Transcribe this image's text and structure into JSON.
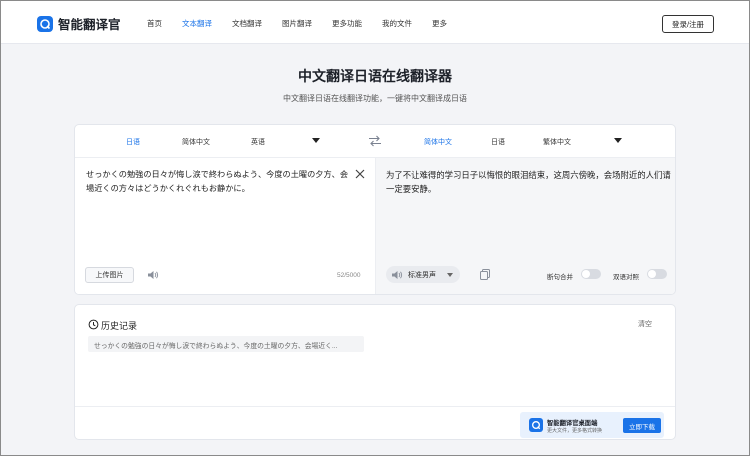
{
  "app": {
    "name": "智能翻译官",
    "accent_color": "#1a73e8"
  },
  "nav": {
    "items": [
      {
        "label": "首页",
        "active": false
      },
      {
        "label": "文本翻译",
        "active": true
      },
      {
        "label": "文档翻译",
        "active": false
      },
      {
        "label": "图片翻译",
        "active": false
      },
      {
        "label": "更多功能",
        "active": false
      },
      {
        "label": "我的文件",
        "active": false
      },
      {
        "label": "更多",
        "active": false
      }
    ],
    "login_label": "登录/注册"
  },
  "page": {
    "title": "中文翻译日语在线翻译器",
    "subtitle": "中文翻译日语在线翻译功能，一键将中文翻译成日语"
  },
  "translator": {
    "source_langs": [
      "日语",
      "简体中文",
      "英语"
    ],
    "source_selected": "日语",
    "target_langs": [
      "简体中文",
      "日语",
      "繁体中文"
    ],
    "target_selected": "简体中文",
    "source_text": "せっかくの勉強の日々が悔し涙で終わらぬよう、今度の土曜の夕方、会場近くの方々はどうかくれぐれもお静かに。",
    "target_text": "为了不让难得的学习日子以悔恨的眼泪结束，这周六傍晚，会场附近的人们请一定要安静。",
    "upload_label": "上传图片",
    "char_count": "52/5000",
    "voice_label": "标准男声",
    "toggles": [
      {
        "label": "断句合并",
        "on": false
      },
      {
        "label": "双语对照",
        "on": false
      }
    ]
  },
  "history": {
    "title": "历史记录",
    "clear_label": "清空",
    "items": [
      "せっかくの勉強の日々が悔し涙で終わらぬよう、今度の土曜の夕方、会場近く..."
    ]
  },
  "promo": {
    "title": "智能翻译官桌面端",
    "subtitle": "更大文件，更多格式转换",
    "button_label": "立即下载"
  }
}
